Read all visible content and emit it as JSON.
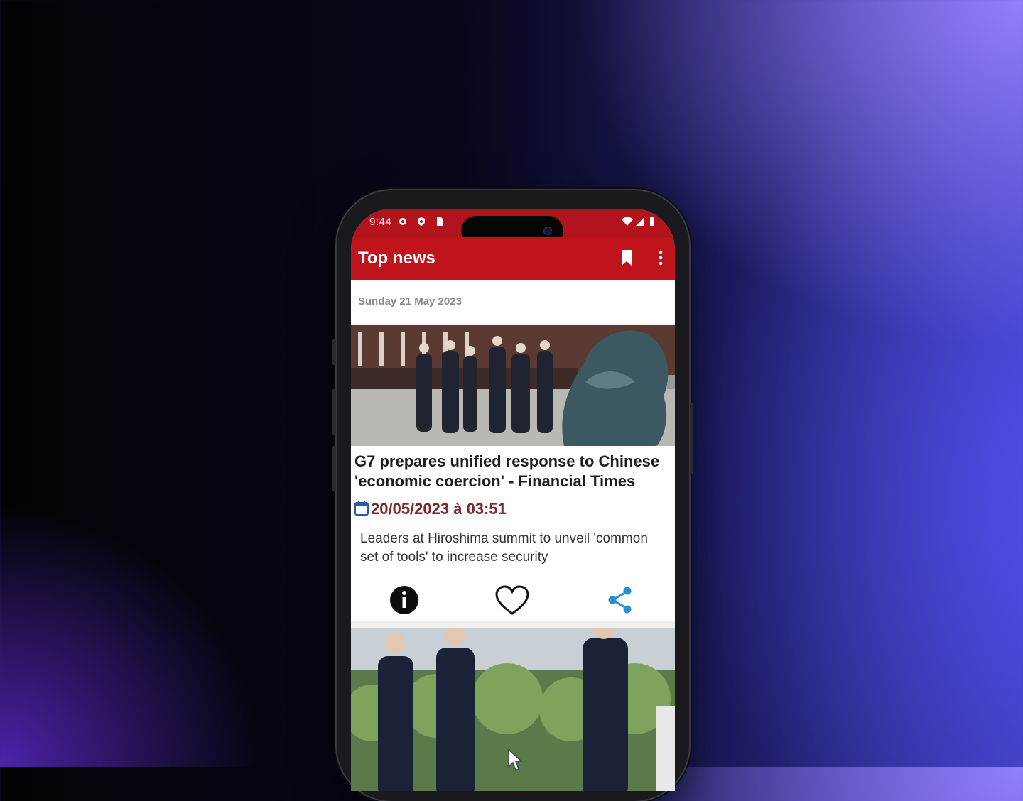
{
  "status_bar": {
    "time": "9:44",
    "left_icons": [
      "settings-icon",
      "shield-icon",
      "sim-card-icon"
    ],
    "right_icons": [
      "wifi-icon",
      "signal-icon",
      "battery-icon"
    ]
  },
  "app_bar": {
    "title": "Top news",
    "bookmark_icon": "bookmark-icon",
    "more_icon": "more-vertical-icon"
  },
  "feed": {
    "date_header": "Sunday 21 May 2023",
    "articles": [
      {
        "headline": "G7 prepares unified response to Chinese 'economic coercion' - Financial Times",
        "published": "20/05/2023 à 03:51",
        "summary": "Leaders at Hiroshima summit to unveil 'common set of tools' to increase security",
        "actions": [
          "info-icon",
          "heart-icon",
          "share-icon"
        ]
      }
    ]
  },
  "colors": {
    "app_bar": "#c0141d",
    "status_bar": "#b3131c",
    "date_text": "#7a2a2a",
    "share_accent": "#2a8fd0"
  }
}
